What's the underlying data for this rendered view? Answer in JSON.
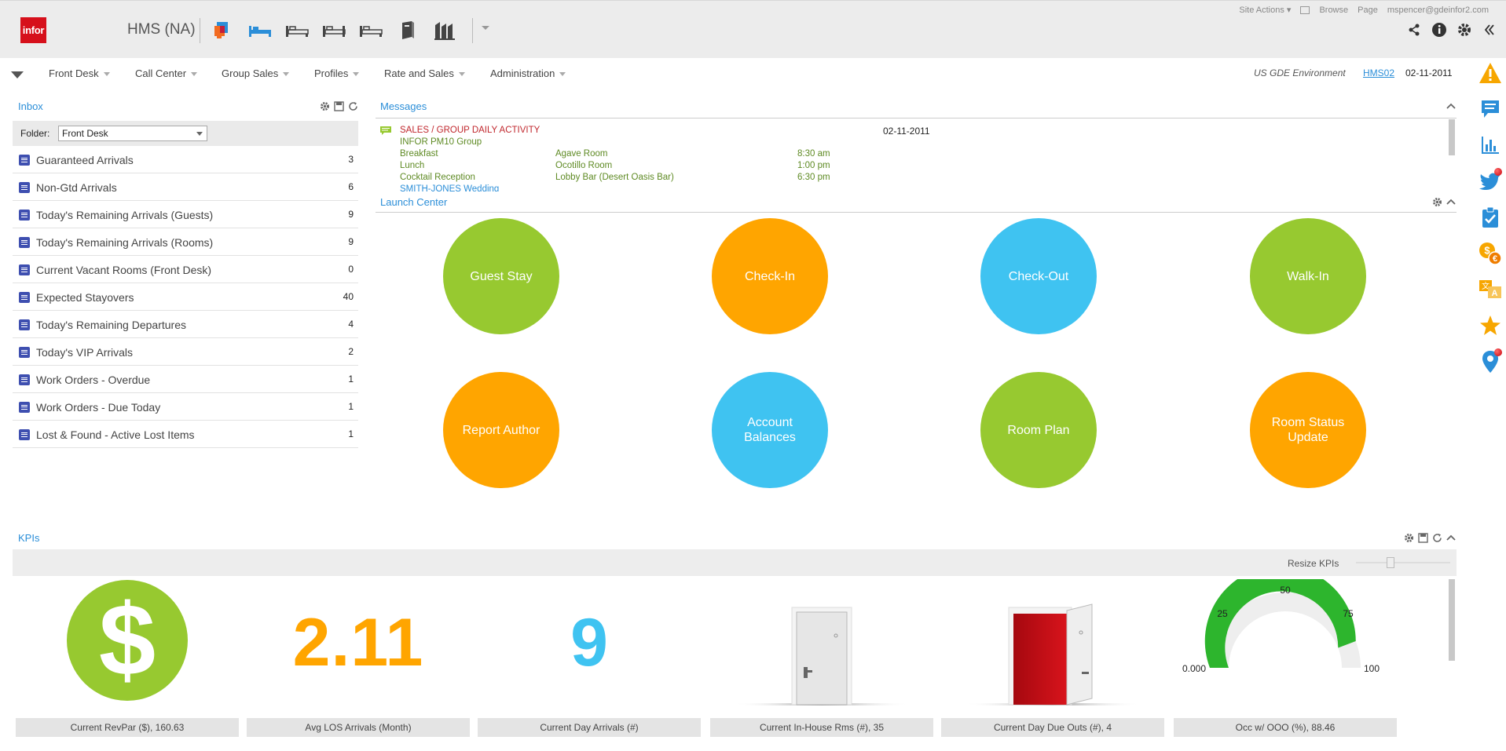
{
  "header": {
    "logo_text": "infor",
    "app_title": "HMS (NA)",
    "top_links": {
      "site_actions": "Site Actions",
      "browse": "Browse",
      "page": "Page",
      "user": "mspencer@gdeinfor2.com"
    },
    "toolbar_icons": [
      "guest-stay-icon",
      "bed-icon",
      "bed-icon",
      "bed-icon",
      "bed-icon",
      "book-icon",
      "building-icon"
    ],
    "right_icons": [
      "share-icon",
      "info-icon",
      "gear-icon",
      "collapse-icon"
    ]
  },
  "nav": {
    "items": [
      "Front Desk",
      "Call Center",
      "Group Sales",
      "Profiles",
      "Rate and Sales",
      "Administration"
    ],
    "environment": "US GDE Environment",
    "property_code": "HMS02",
    "business_date": "02-11-2011"
  },
  "inbox": {
    "title": "Inbox",
    "folder_label": "Folder:",
    "folder_value": "Front Desk",
    "items": [
      {
        "label": "Guaranteed Arrivals",
        "count": "3"
      },
      {
        "label": "Non-Gtd Arrivals",
        "count": "6"
      },
      {
        "label": "Today's Remaining Arrivals (Guests)",
        "count": "9"
      },
      {
        "label": "Today's Remaining Arrivals (Rooms)",
        "count": "9"
      },
      {
        "label": "Current Vacant Rooms (Front Desk)",
        "count": "0"
      },
      {
        "label": "Expected Stayovers",
        "count": "40"
      },
      {
        "label": "Today's Remaining Departures",
        "count": "4"
      },
      {
        "label": "Today's VIP Arrivals",
        "count": "2"
      },
      {
        "label": "Work Orders - Overdue",
        "count": "1"
      },
      {
        "label": "Work Orders - Due Today",
        "count": "1"
      },
      {
        "label": "Lost & Found - Active Lost Items",
        "count": "1"
      }
    ]
  },
  "messages": {
    "title": "Messages",
    "subject": "SALES / GROUP DAILY ACTIVITY",
    "date": "02-11-2011",
    "group": "INFOR PM10 Group",
    "rows": [
      {
        "event": "Breakfast",
        "room": "Agave Room",
        "time": "8:30 am"
      },
      {
        "event": "Lunch",
        "room": "Ocotillo Room",
        "time": "1:00 pm"
      },
      {
        "event": "Cocktail Reception",
        "room": "Lobby Bar (Desert Oasis Bar)",
        "time": "6:30 pm"
      }
    ],
    "next_group": "SMITH-JONES Wedding"
  },
  "launch_center": {
    "title": "Launch Center",
    "buttons": [
      {
        "label": "Guest Stay",
        "color": "#97c930"
      },
      {
        "label": "Check-In",
        "color": "#ffa500"
      },
      {
        "label": "Check-Out",
        "color": "#3fc3f1"
      },
      {
        "label": "Walk-In",
        "color": "#97c930"
      },
      {
        "label": "Report Author",
        "color": "#ffa500"
      },
      {
        "label": "Account Balances",
        "color": "#3fc3f1"
      },
      {
        "label": "Room Plan",
        "color": "#97c930"
      },
      {
        "label": "Room Status Update",
        "color": "#ffa500"
      }
    ]
  },
  "kpis": {
    "title": "KPIs",
    "resize_label": "Resize KPIs",
    "tiles": [
      {
        "caption": "Current RevPar ($), 160.63",
        "symbol": "$"
      },
      {
        "caption": "Avg LOS Arrivals (Month)",
        "value": "2.11"
      },
      {
        "caption": "Current Day Arrivals (#)",
        "value": "9"
      },
      {
        "caption": "Current In-House Rms (#), 35"
      },
      {
        "caption": "Current Day Due Outs (#), 4"
      },
      {
        "caption": "Occ w/ OOO (%), 88.46"
      }
    ],
    "gauge": {
      "min": "0.000",
      "ticks": [
        "25",
        "50",
        "75"
      ],
      "max": "100",
      "value": 88.46
    }
  },
  "right_rail": [
    "warning-icon",
    "messages-icon",
    "chart-icon",
    "twitter-icon",
    "clipboard-icon",
    "currency-icon",
    "translate-icon",
    "star-icon",
    "location-icon"
  ],
  "colors": {
    "accent_blue": "#2b8ed8",
    "green": "#97c930",
    "orange": "#ffa500",
    "light_blue": "#3fc3f1",
    "message_red": "#c0272d",
    "message_green": "#5e8a23"
  }
}
